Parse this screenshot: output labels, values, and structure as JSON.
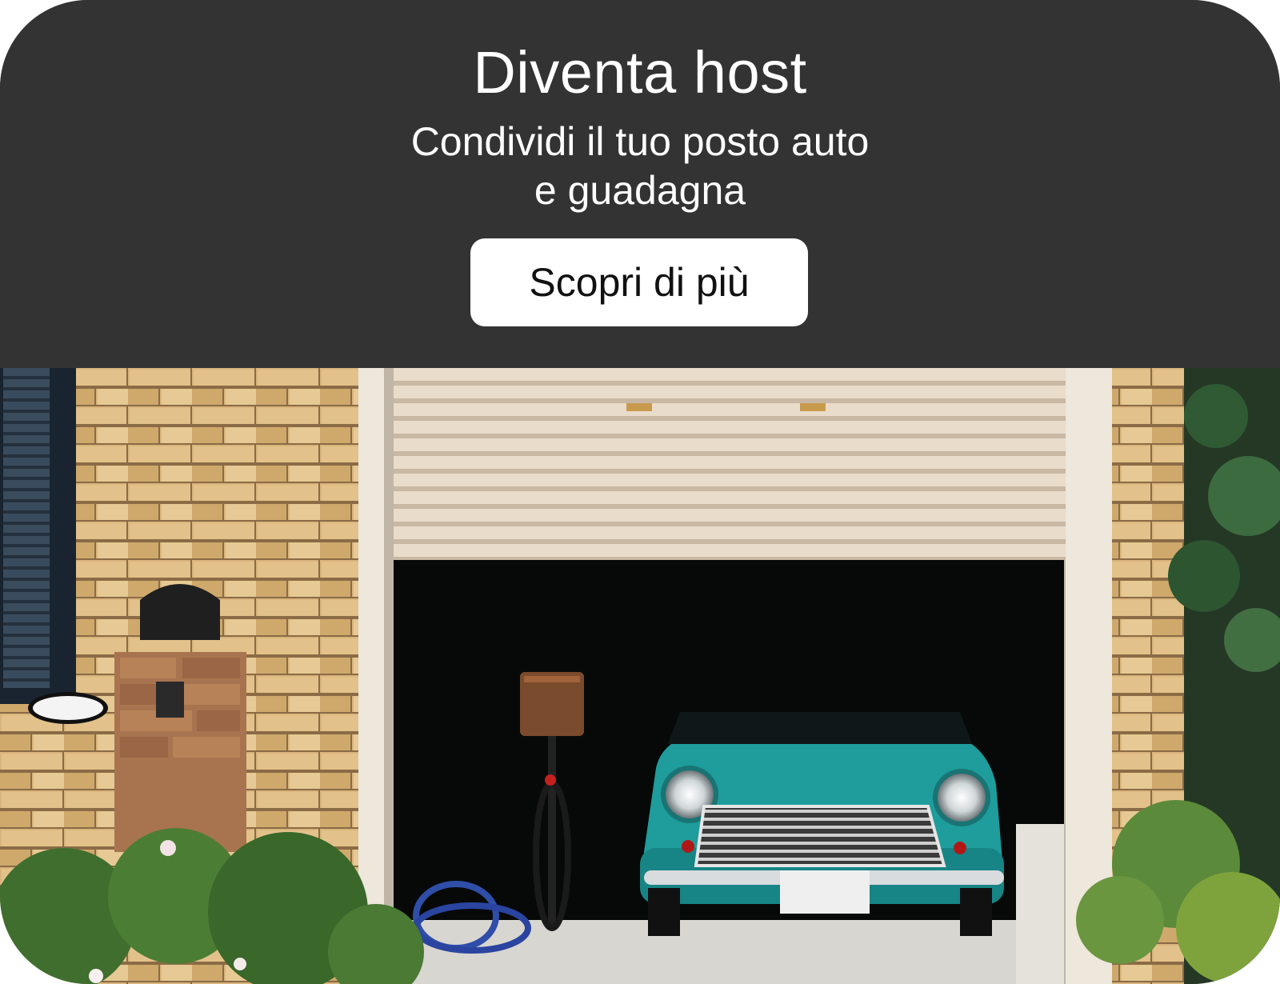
{
  "banner": {
    "title": "Diventa host",
    "subtitle_line1": "Condividi il tuo posto auto",
    "subtitle_line2": "e guadagna",
    "cta_label": "Scopri di più"
  },
  "colors": {
    "header_bg": "#333333",
    "header_text": "#ffffff",
    "cta_bg": "#ffffff",
    "cta_text": "#111111",
    "car": "#1f9c9c"
  },
  "photo": {
    "subject": "garage-with-classic-car"
  }
}
